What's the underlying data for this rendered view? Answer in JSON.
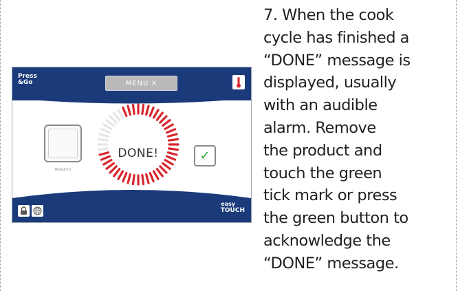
{
  "instructions": {
    "text": "7. When the cook\ncycle has finished a\n“DONE” message is\ndisplayed, usually\nwith an audible\nalarm. Remove\nthe product and\ntouch the green\ntick mark or press\nthe green button to\nacknowledge the\n“DONE” message."
  },
  "device": {
    "logo_line1": "Press",
    "logo_line2": "&Go",
    "menu_label": "MENU X",
    "product_label": "PRODUCT X",
    "done_message": "DONE!",
    "tick_symbol": "✓",
    "footer_logo_line1": "easy",
    "footer_logo_line2": "TOUCH",
    "icons": [
      "thermometer-icon",
      "lock-icon",
      "globe-icon",
      "check-icon"
    ],
    "colors": {
      "header_blue": "#1a3a7a",
      "menu_gray": "#b9b9b9",
      "ring_red": "#d8262d",
      "ring_pending": "#e6e6e6",
      "tick_green": "#2aa63a"
    }
  }
}
